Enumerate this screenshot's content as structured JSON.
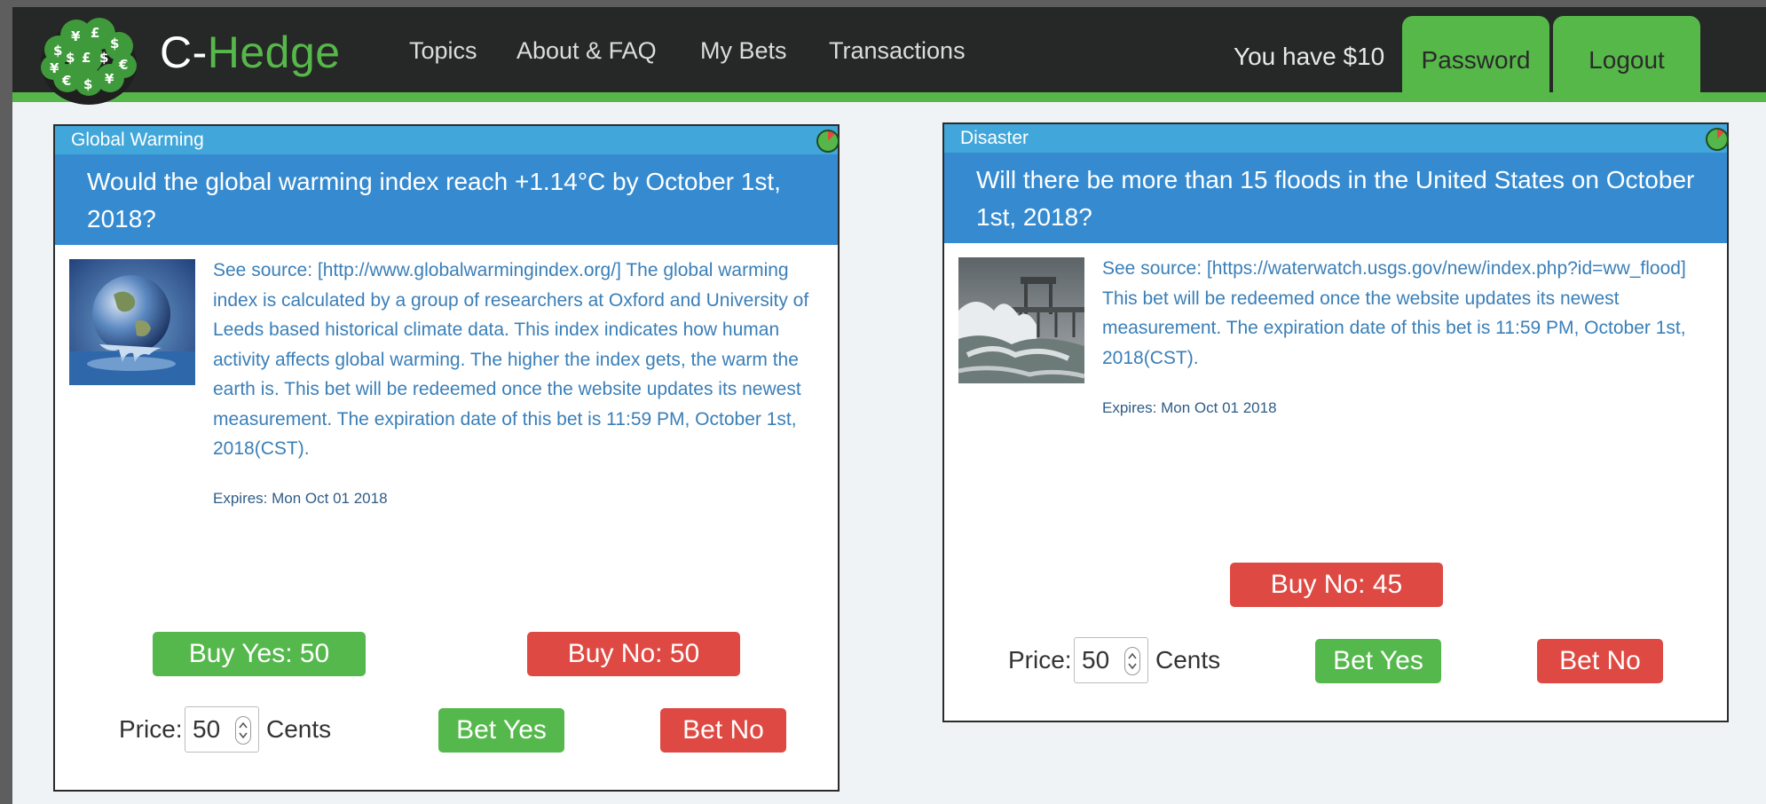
{
  "header": {
    "brand_prefix": "C-",
    "brand_suffix": "Hedge",
    "nav": [
      {
        "label": "Topics"
      },
      {
        "label": "About & FAQ"
      },
      {
        "label": "My Bets"
      },
      {
        "label": "Transactions"
      }
    ],
    "balance": "You have $10",
    "password_label": "Password",
    "logout_label": "Logout",
    "logo_icon": "brain-currency-logo-icon"
  },
  "colors": {
    "header_bg": "#262827",
    "accent_green": "#57b84a",
    "category_blue": "#41a6da",
    "question_blue": "#368bd0",
    "buy_no_red": "#de4a43",
    "text_blue": "#3a7fb8"
  },
  "cards": [
    {
      "category": "Global Warming",
      "question": "Would the global warming index reach +1.14°C by October 1st, 2018?",
      "description": "See source: [http://www.globalwarmingindex.org/] The global warming index is calculated by a group of researchers at Oxford and University of Leeds based historical climate data. This index indicates how human activity affects global warming. The higher the index gets, the warm the earth is. This bet will be redeemed once the website updates its newest measurement. The expiration date of this bet is 11:59 PM, October 1st, 2018(CST).",
      "expires": "Expires: Mon Oct 01 2018",
      "buy_yes": "Buy Yes: 50",
      "buy_no": "Buy No: 50",
      "price_label": "Price:",
      "price_value": "50",
      "cents_label": "Cents",
      "bet_yes": "Bet Yes",
      "bet_no": "Bet No",
      "image_icon": "melting-earth-image"
    },
    {
      "category": "Disaster",
      "question": "Will there be more than 15 floods in the United States on October 1st, 2018?",
      "description": "See source: [https://waterwatch.usgs.gov/new/index.php?id=ww_flood] This bet will be redeemed once the website updates its newest measurement. The expiration date of this bet is 11:59 PM, October 1st, 2018(CST).",
      "expires": "Expires: Mon Oct 01 2018",
      "buy_no": "Buy No: 45",
      "price_label": "Price:",
      "price_value": "50",
      "cents_label": "Cents",
      "bet_yes": "Bet Yes",
      "bet_no": "Bet No",
      "image_icon": "storm-pier-image"
    }
  ]
}
